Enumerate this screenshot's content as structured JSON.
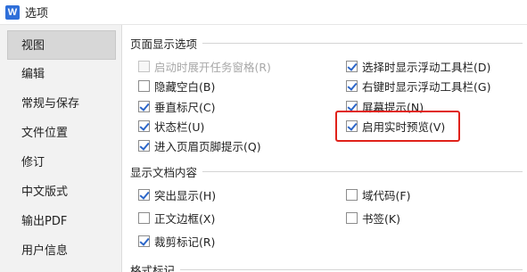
{
  "window": {
    "icon_letter": "W",
    "title": "选项"
  },
  "sidebar": {
    "items": [
      {
        "label": "视图",
        "active": true
      },
      {
        "label": "编辑",
        "active": false
      },
      {
        "label": "常规与保存",
        "active": false
      },
      {
        "label": "文件位置",
        "active": false
      },
      {
        "label": "修订",
        "active": false
      },
      {
        "label": "中文版式",
        "active": false
      },
      {
        "label": "输出PDF",
        "active": false
      },
      {
        "label": "用户信息",
        "active": false
      }
    ]
  },
  "page_display": {
    "title": "页面显示选项",
    "left": [
      {
        "label": "启动时展开任务窗格(R)",
        "checked": false,
        "disabled": true
      },
      {
        "label": "隐藏空白(B)",
        "checked": false,
        "disabled": false
      },
      {
        "label": "垂直标尺(C)",
        "checked": true,
        "disabled": false
      },
      {
        "label": "状态栏(U)",
        "checked": true,
        "disabled": false
      },
      {
        "label": "进入页眉页脚提示(Q)",
        "checked": true,
        "disabled": false
      }
    ],
    "right": [
      {
        "label": "选择时显示浮动工具栏(D)",
        "checked": true,
        "disabled": false
      },
      {
        "label": "右键时显示浮动工具栏(G)",
        "checked": true,
        "disabled": false
      },
      {
        "label": "屏幕提示(N)",
        "checked": true,
        "disabled": false
      },
      {
        "label": "启用实时预览(V)",
        "checked": true,
        "disabled": false
      }
    ]
  },
  "doc_content": {
    "title": "显示文档内容",
    "left": [
      {
        "label": "突出显示(H)",
        "checked": true
      },
      {
        "label": "正文边框(X)",
        "checked": false
      },
      {
        "label": "裁剪标记(R)",
        "checked": true
      }
    ],
    "right": [
      {
        "label": "域代码(F)",
        "checked": false
      },
      {
        "label": "书签(K)",
        "checked": false
      }
    ]
  },
  "format_marks": {
    "title": "格式标记"
  },
  "colors": {
    "highlight": "#e0221a",
    "check": "#2c66c8",
    "app_icon": "#2f6fd9"
  }
}
